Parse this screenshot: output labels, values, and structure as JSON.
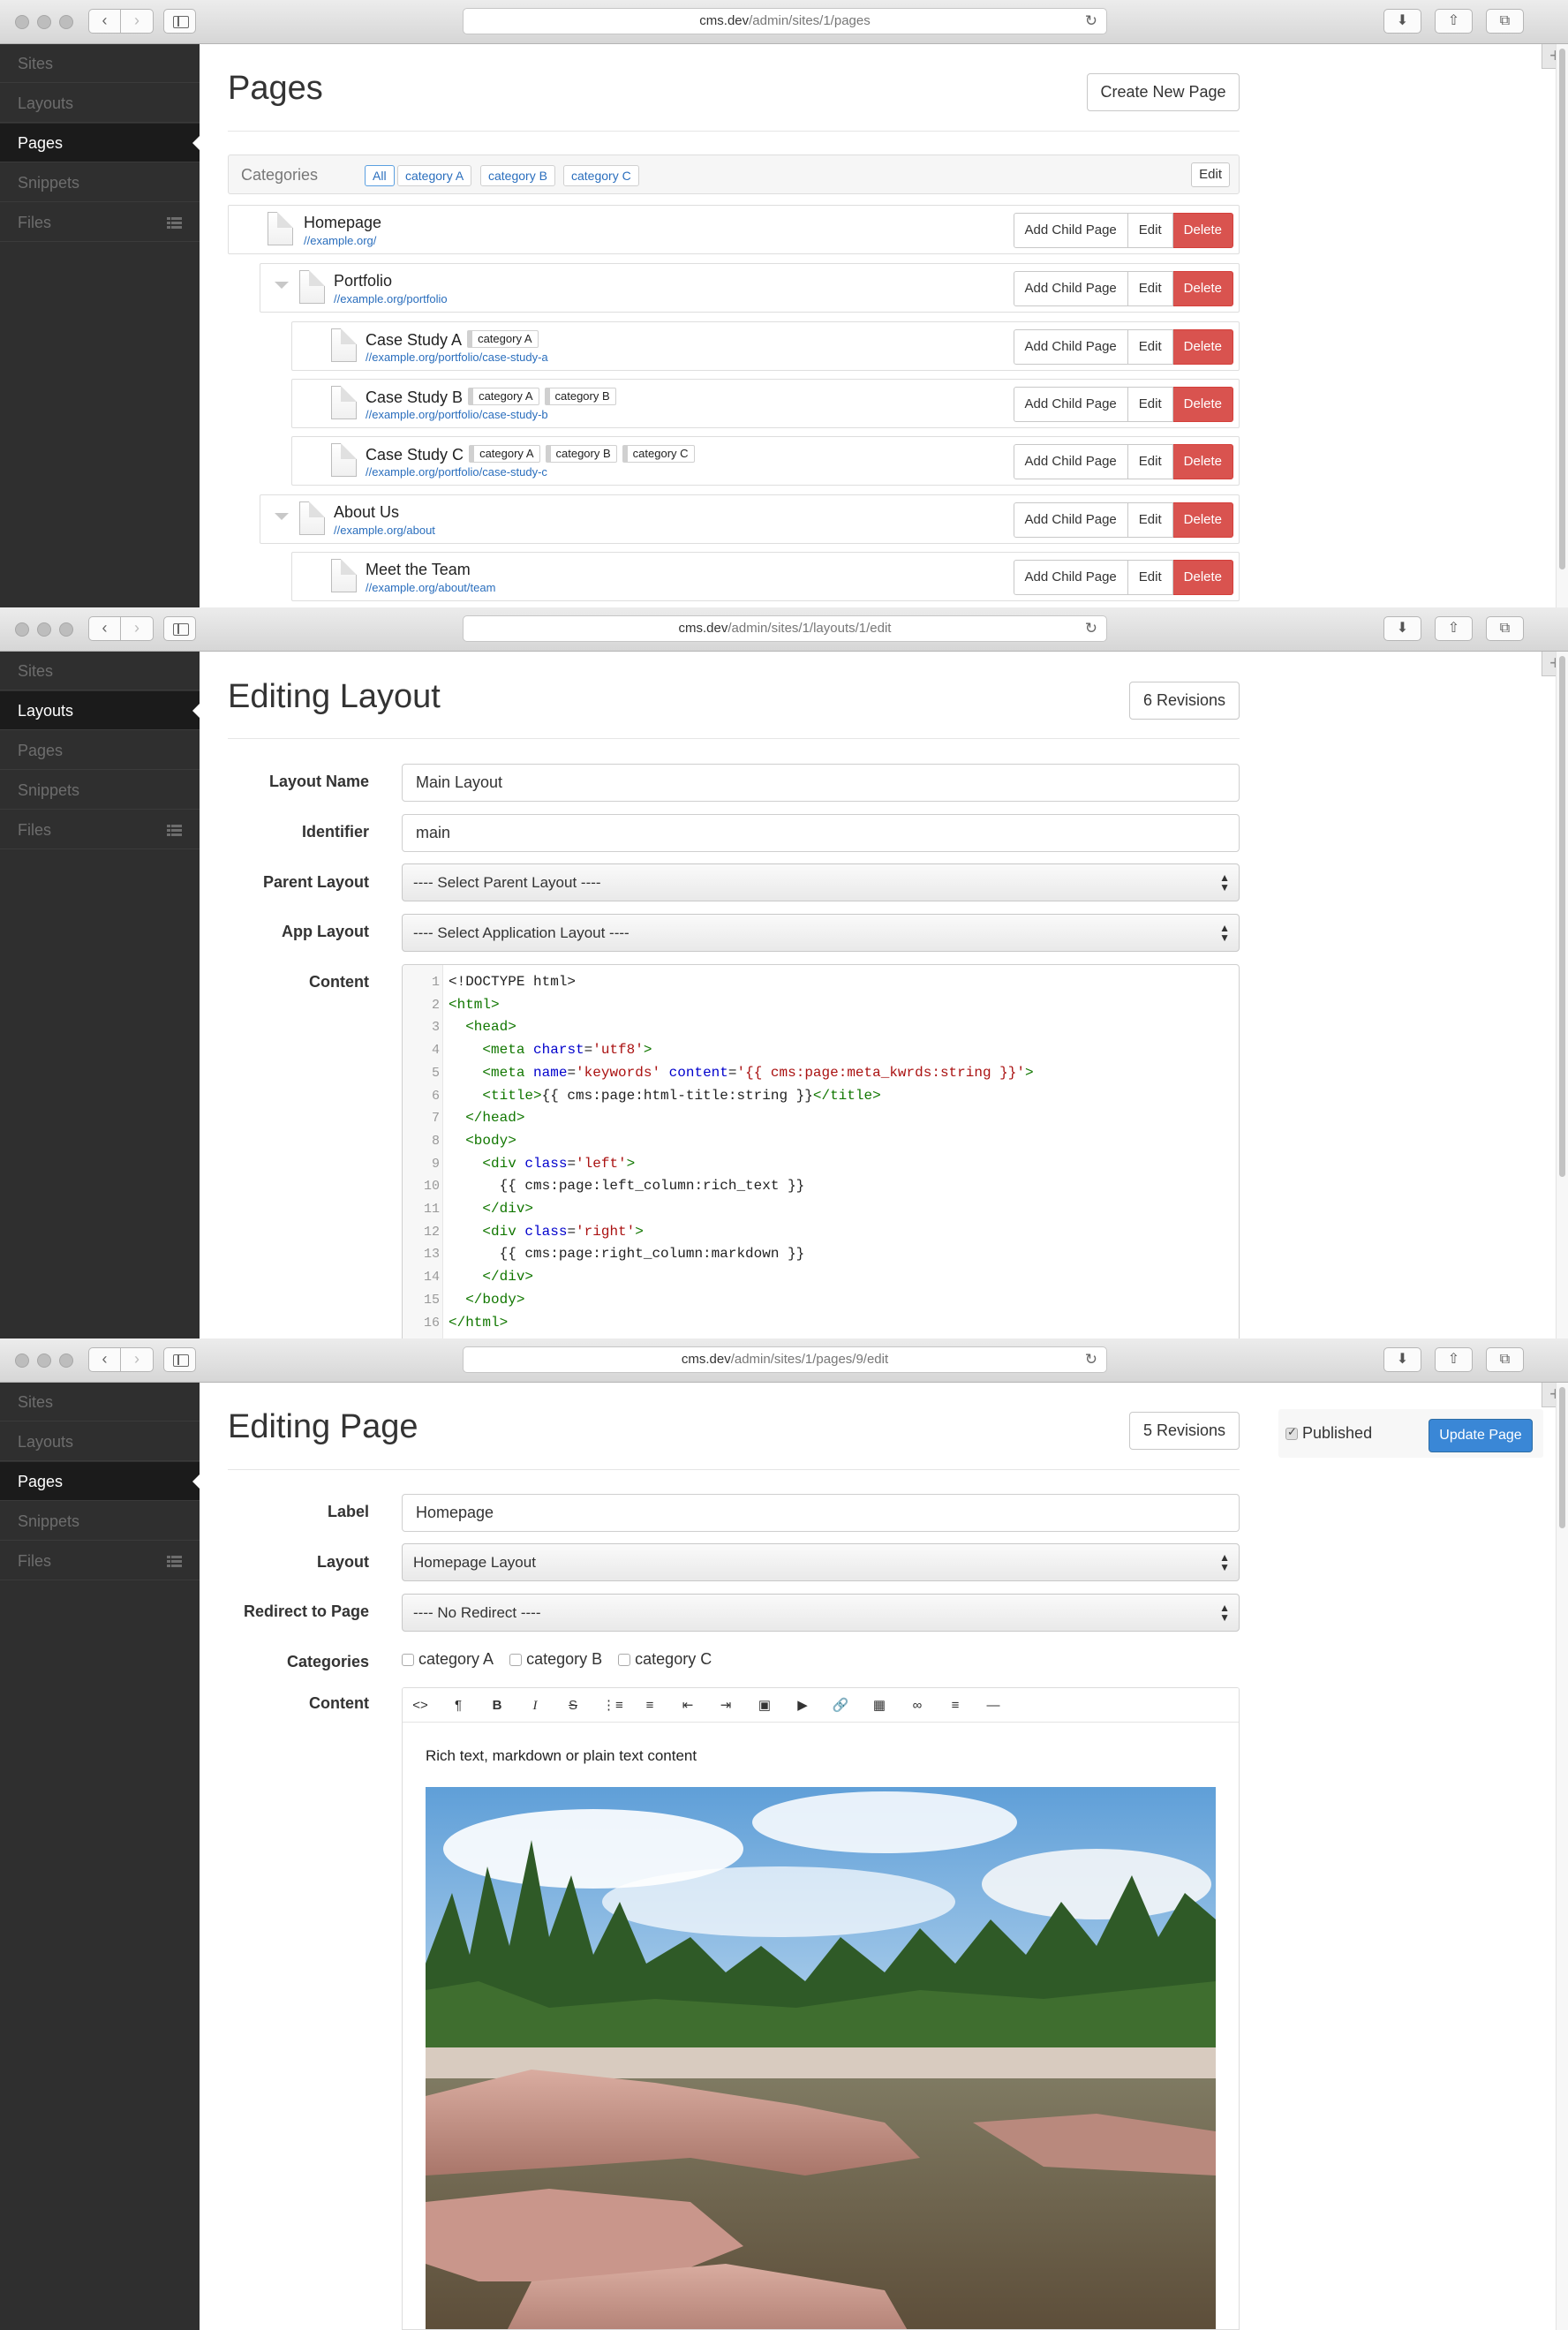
{
  "windows": {
    "pages": {
      "url_host": "cms.dev",
      "url_path": "/admin/sites/1/pages"
    },
    "layout": {
      "url_host": "cms.dev",
      "url_path": "/admin/sites/1/layouts/1/edit"
    },
    "page": {
      "url_host": "cms.dev",
      "url_path": "/admin/sites/1/pages/9/edit"
    }
  },
  "sidebar": {
    "items": [
      {
        "label": "Sites"
      },
      {
        "label": "Layouts"
      },
      {
        "label": "Pages"
      },
      {
        "label": "Snippets"
      },
      {
        "label": "Files"
      }
    ]
  },
  "pages_view": {
    "title": "Pages",
    "create_button": "Create New Page",
    "categories_label": "Categories",
    "category_filters": [
      "All",
      "category A",
      "category B",
      "category C"
    ],
    "categories_edit": "Edit",
    "actions": {
      "add_child": "Add Child Page",
      "edit": "Edit",
      "delete": "Delete"
    },
    "rows": [
      {
        "name": "Homepage",
        "url": "//example.org/",
        "tags": []
      },
      {
        "name": "Portfolio",
        "url": "//example.org/portfolio",
        "tags": []
      },
      {
        "name": "Case Study A",
        "url": "//example.org/portfolio/case-study-a",
        "tags": [
          "category A"
        ]
      },
      {
        "name": "Case Study B",
        "url": "//example.org/portfolio/case-study-b",
        "tags": [
          "category A",
          "category B"
        ]
      },
      {
        "name": "Case Study C",
        "url": "//example.org/portfolio/case-study-c",
        "tags": [
          "category A",
          "category B",
          "category C"
        ]
      },
      {
        "name": "About Us",
        "url": "//example.org/about",
        "tags": []
      },
      {
        "name": "Meet the Team",
        "url": "//example.org/about/team",
        "tags": []
      }
    ]
  },
  "layout_view": {
    "title": "Editing Layout",
    "revisions_button": "6 Revisions",
    "fields": {
      "layout_name_label": "Layout Name",
      "layout_name_value": "Main Layout",
      "identifier_label": "Identifier",
      "identifier_value": "main",
      "parent_layout_label": "Parent Layout",
      "parent_layout_value": "---- Select Parent Layout ----",
      "app_layout_label": "App Layout",
      "app_layout_value": "---- Select Application Layout ----",
      "content_label": "Content"
    },
    "code_lines": [
      "<!DOCTYPE html>",
      "<html>",
      "  <head>",
      "    <meta charst='utf8'>",
      "    <meta name='keywords' content='{{ cms:page:meta_kwrds:string }}'>",
      "    <title>{{ cms:page:html-title:string }}</title>",
      "  </head>",
      "  <body>",
      "    <div class='left'>",
      "      {{ cms:page:left_column:rich_text }}",
      "    </div>",
      "    <div class='right'>",
      "      {{ cms:page:right_column:markdown }}",
      "    </div>",
      "  </body>",
      "</html>"
    ]
  },
  "page_view": {
    "title": "Editing Page",
    "revisions_button": "5 Revisions",
    "published_label": "Published",
    "update_button": "Update Page",
    "fields": {
      "label_label": "Label",
      "label_value": "Homepage",
      "layout_label": "Layout",
      "layout_value": "Homepage Layout",
      "redirect_label": "Redirect to Page",
      "redirect_value": "---- No Redirect ----",
      "categories_label": "Categories",
      "content_label": "Content"
    },
    "category_options": [
      "category A",
      "category B",
      "category C"
    ],
    "toolbar_icons": [
      "code-icon",
      "paragraph-icon",
      "bold-icon",
      "italic-icon",
      "strikethrough-icon",
      "unordered-list-icon",
      "ordered-list-icon",
      "outdent-icon",
      "indent-icon",
      "image-icon",
      "video-icon",
      "link-icon",
      "table-icon",
      "chain-icon",
      "align-icon",
      "horizontal-rule-icon"
    ],
    "editor_text": "Rich text, markdown or plain text content"
  },
  "colors": {
    "sidebar_bg": "#2f2f2f",
    "danger": "#d9534f",
    "primary": "#3a87d6",
    "link": "#2a6ebd"
  }
}
